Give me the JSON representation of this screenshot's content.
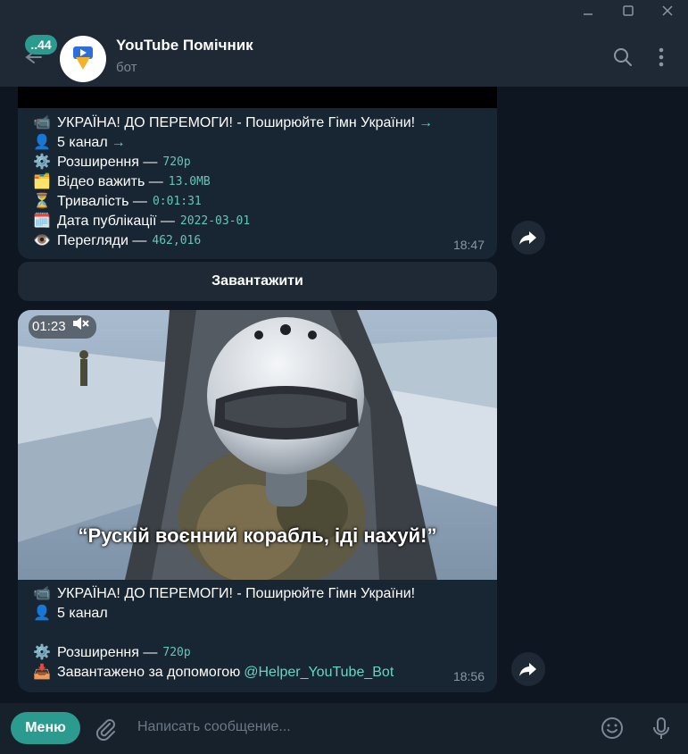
{
  "header": {
    "badge": "..44",
    "title": "YouTube Помічник",
    "subtitle": "бот"
  },
  "message1": {
    "lines": [
      {
        "emoji": "📹",
        "label": "УКРАЇНА! ДО ПЕРЕМОГИ! - Поширюйте Гімн України!",
        "value": "",
        "arrow": "→"
      },
      {
        "emoji": "👤",
        "label": "5 канал",
        "value": "",
        "arrow": "→"
      },
      {
        "emoji": "⚙️",
        "label": "Розширення —",
        "value": "720p",
        "arrow": ""
      },
      {
        "emoji": "🗂️",
        "label": "Відео важить —",
        "value": "13.0MB",
        "arrow": ""
      },
      {
        "emoji": "⏳",
        "label": "Тривалість —",
        "value": "0:01:31",
        "arrow": ""
      },
      {
        "emoji": "🗓️",
        "label": "Дата публікації —",
        "value": "2022-03-01",
        "arrow": ""
      },
      {
        "emoji": "👁️",
        "label": "Перегляди —",
        "value": "462,016",
        "arrow": ""
      }
    ],
    "time": "18:47"
  },
  "keyboard_button": {
    "label": "Завантажити"
  },
  "message2": {
    "video_time": "01:23",
    "video_subtitle": "“Рускій воєнний корабль, іді нахуй!”",
    "lines": [
      {
        "emoji": "📹",
        "label": "УКРАЇНА! ДО ПЕРЕМОГИ! - Поширюйте Гімн України!"
      },
      {
        "emoji": "👤",
        "label": "5 канал"
      },
      {
        "emoji": "",
        "label": ""
      },
      {
        "emoji": "⚙️",
        "label": "Розширення —",
        "value": "720p"
      },
      {
        "emoji": "📥",
        "label": "Завантажено за допомогою",
        "link": "@Helper_YouTube_Bot"
      }
    ],
    "time": "18:56"
  },
  "composer": {
    "menu_label": "Меню",
    "placeholder": "Написать сообщение..."
  },
  "colors": {
    "accent": "#2b9b8f",
    "link": "#63d7c4",
    "bubble": "#182533",
    "background": "#0e1621"
  }
}
